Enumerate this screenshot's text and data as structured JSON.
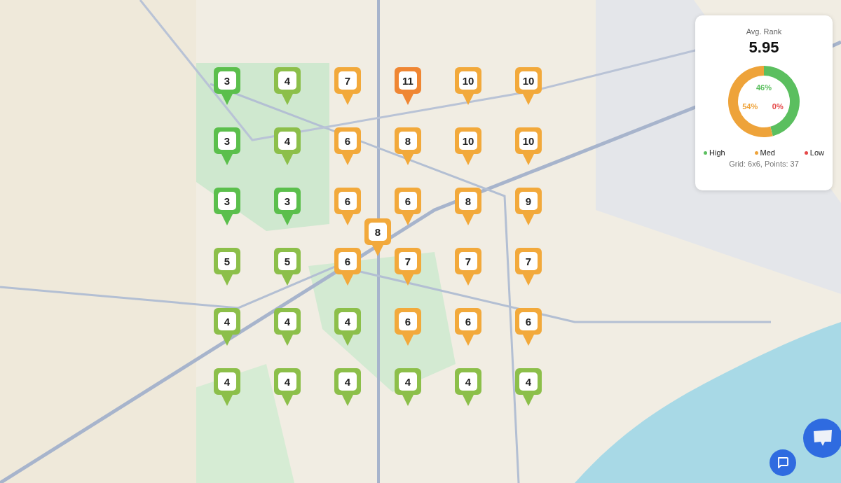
{
  "pins": [
    {
      "value": "3",
      "color": "#5bbf4c"
    },
    {
      "value": "4",
      "color": "#8cbf4a"
    },
    {
      "value": "7",
      "color": "#f2a93b"
    },
    {
      "value": "11",
      "color": "#ef8633"
    },
    {
      "value": "10",
      "color": "#f2a93b"
    },
    {
      "value": "10",
      "color": "#f2a93b"
    },
    {
      "value": "3",
      "color": "#5bbf4c"
    },
    {
      "value": "4",
      "color": "#8cbf4a"
    },
    {
      "value": "6",
      "color": "#f2a93b"
    },
    {
      "value": "8",
      "color": "#f2a93b"
    },
    {
      "value": "10",
      "color": "#f2a93b"
    },
    {
      "value": "10",
      "color": "#f2a93b"
    },
    {
      "value": "3",
      "color": "#5bbf4c"
    },
    {
      "value": "3",
      "color": "#5bbf4c"
    },
    {
      "value": "6",
      "color": "#f2a93b"
    },
    {
      "value": "6",
      "color": "#f2a93b"
    },
    {
      "value": "8",
      "color": "#f2a93b"
    },
    {
      "value": "9",
      "color": "#f2a93b"
    },
    {
      "value": "5",
      "color": "#8cbf4a"
    },
    {
      "value": "5",
      "color": "#8cbf4a"
    },
    {
      "value": "6",
      "color": "#f2a93b"
    },
    {
      "value": "7",
      "color": "#f2a93b"
    },
    {
      "value": "7",
      "color": "#f2a93b"
    },
    {
      "value": "7",
      "color": "#f2a93b"
    },
    {
      "value": "4",
      "color": "#8cbf4a"
    },
    {
      "value": "4",
      "color": "#8cbf4a"
    },
    {
      "value": "4",
      "color": "#8cbf4a"
    },
    {
      "value": "6",
      "color": "#f2a93b"
    },
    {
      "value": "6",
      "color": "#f2a93b"
    },
    {
      "value": "6",
      "color": "#f2a93b"
    },
    {
      "value": "4",
      "color": "#8cbf4a"
    },
    {
      "value": "4",
      "color": "#8cbf4a"
    },
    {
      "value": "4",
      "color": "#8cbf4a"
    },
    {
      "value": "4",
      "color": "#8cbf4a"
    },
    {
      "value": "4",
      "color": "#8cbf4a"
    },
    {
      "value": "4",
      "color": "#8cbf4a"
    }
  ],
  "center_pin": {
    "value": "8",
    "color": "#f2a93b"
  },
  "summary": {
    "title": "Avg. Rank",
    "value": "5.95",
    "chart_data": {
      "type": "donut",
      "categories": [
        "High",
        "Med",
        "Low"
      ],
      "series": [
        {
          "values": [
            46,
            54,
            0
          ]
        }
      ],
      "value_labels": [
        "46%",
        "54%",
        "0%"
      ]
    },
    "legend": [
      {
        "color": "#5bbf5f"
      },
      {
        "color": "#eea33a"
      },
      {
        "color": "#e54848"
      }
    ],
    "footer": "Grid: 6x6, Points: 37"
  }
}
